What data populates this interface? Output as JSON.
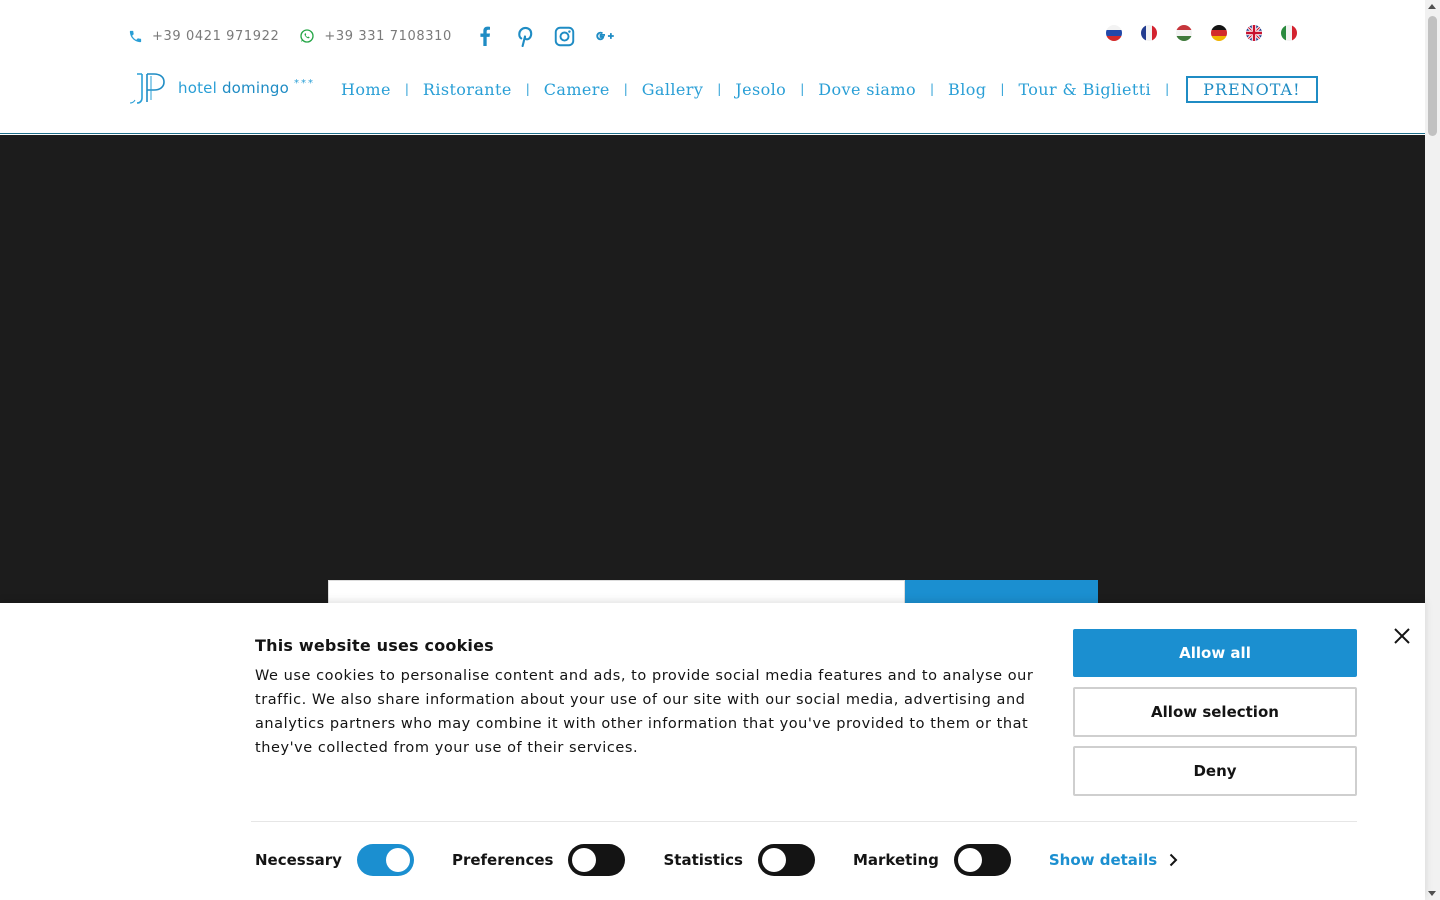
{
  "header": {
    "phone": "+39 0421 971922",
    "whatsapp": "+39 331 7108310",
    "social": [
      "facebook-icon",
      "pinterest-icon",
      "instagram-icon",
      "google-plus-icon"
    ],
    "languages": [
      "ru",
      "fr",
      "hu",
      "de",
      "en",
      "it"
    ],
    "logo": {
      "text": "hotel",
      "name": "domingo",
      "stars": "***"
    },
    "nav": [
      "Home",
      "Ristorante",
      "Camere",
      "Gallery",
      "Jesolo",
      "Dove siamo",
      "Blog",
      "Tour & Biglietti"
    ],
    "nav_separator": "|",
    "book_label": "PRENOTA!"
  },
  "colors": {
    "accent": "#1b8fd0",
    "nav": "#2a9fd6",
    "hero": "#1c1c1c",
    "whatsapp": "#25a647"
  },
  "cookie": {
    "title": "This website uses cookies",
    "text": "We use cookies to personalise content and ads, to provide social media features and to analyse our traffic. We also share information about your use of our site with our social media, advertising and analytics partners who may combine it with other information that you've provided to them or that they've collected from your use of their services.",
    "allow_all": "Allow all",
    "allow_selection": "Allow selection",
    "deny": "Deny",
    "toggles": [
      {
        "label": "Necessary",
        "on": true
      },
      {
        "label": "Preferences",
        "on": false
      },
      {
        "label": "Statistics",
        "on": false
      },
      {
        "label": "Marketing",
        "on": false
      }
    ],
    "show_details": "Show details"
  }
}
